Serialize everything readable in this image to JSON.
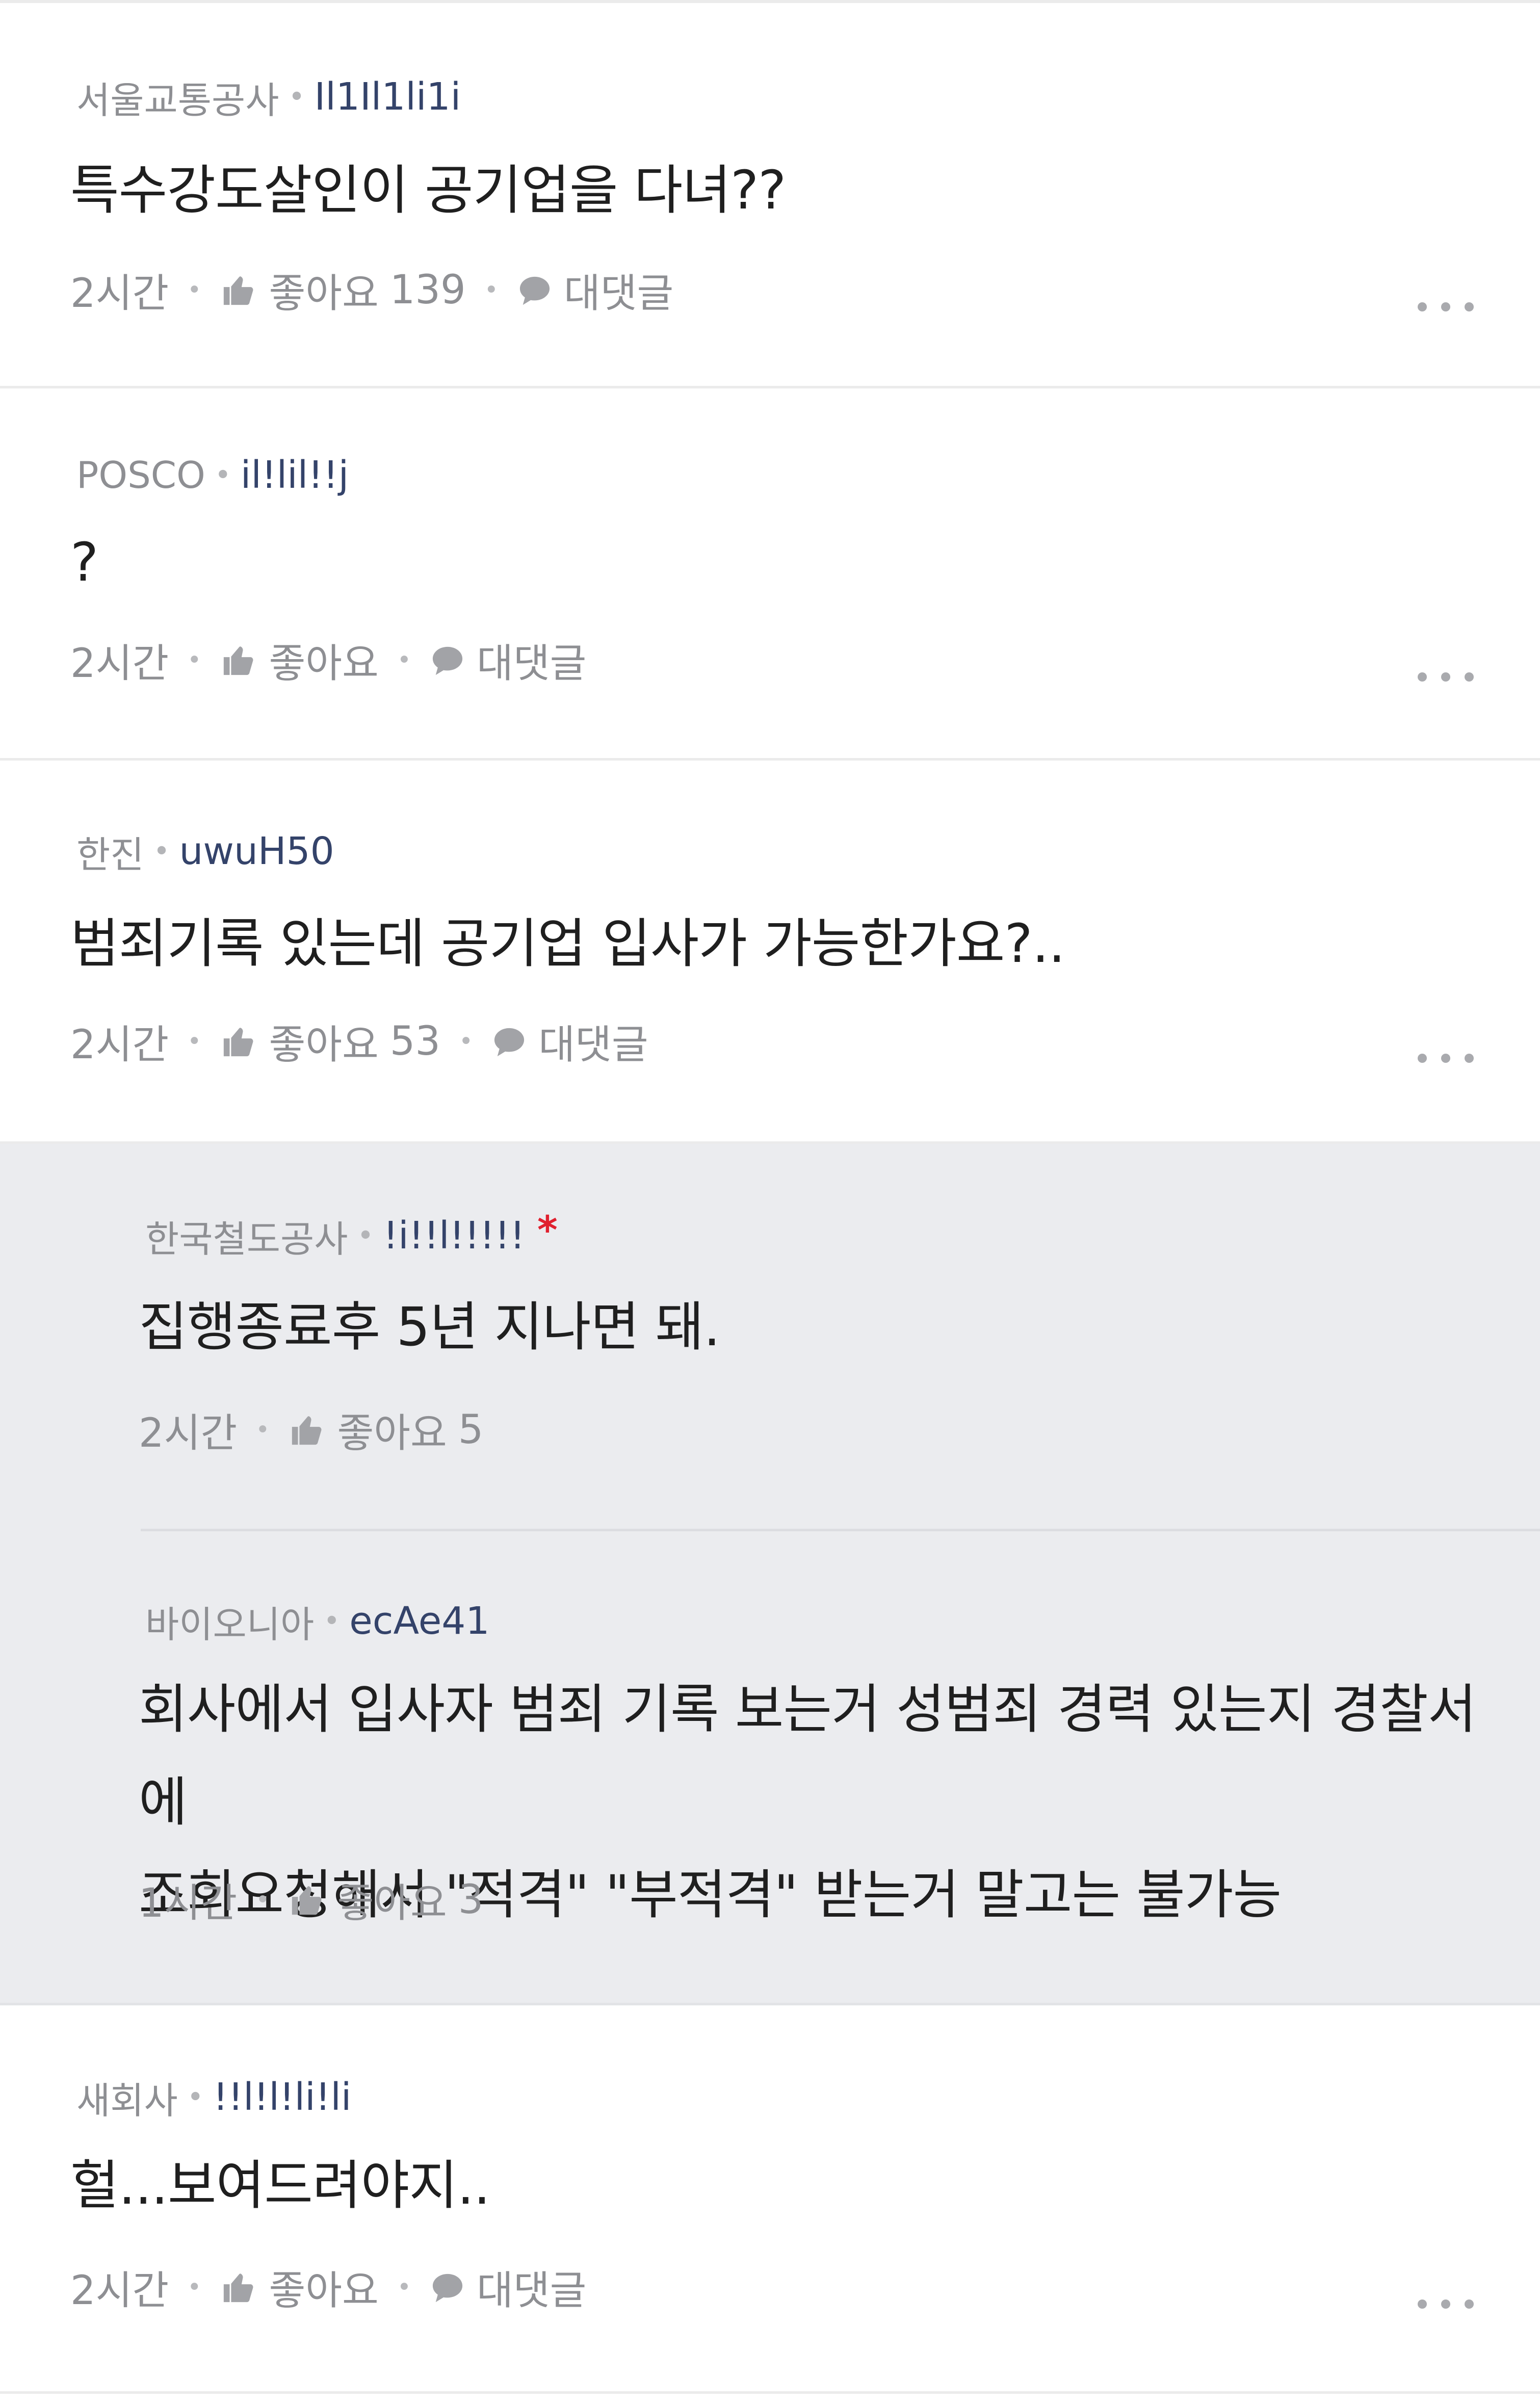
{
  "labels": {
    "like": "좋아요",
    "reply": "대댓글"
  },
  "comments": [
    {
      "company": "서울교통공사",
      "nickname": "Il1Il1li1i",
      "text": "특수강도살인이 공기업을 다녀??",
      "time": "2시간",
      "likes": "139"
    },
    {
      "company": "POSCO",
      "nickname": "il!lil!!j",
      "text": "?",
      "time": "2시간",
      "likes": ""
    },
    {
      "company": "한진",
      "nickname": "uwuH50",
      "text": "범죄기록 있는데 공기업 입사가 가능한가요?..",
      "time": "2시간",
      "likes": "53",
      "replies": [
        {
          "company": "한국철도공사",
          "nickname": "!i!!l!!!!!",
          "badge": "*",
          "text": "집행종료후 5년 지나면 돼.",
          "time": "2시간",
          "likes": "5"
        },
        {
          "company": "바이오니아",
          "nickname": "ecAe41",
          "text_lines": [
            "회사에서 입사자 범죄 기록 보는거 성범죄 경력 있는지 경찰서에",
            "조회요청해서 \"적격\" \"부적격\" 받는거 말고는 불가능"
          ],
          "time": "1시간",
          "likes": "3"
        }
      ]
    },
    {
      "company": "새회사",
      "nickname": "!!l!l!li!li",
      "text": "헐...보여드려야지..",
      "time": "2시간",
      "likes": ""
    }
  ]
}
